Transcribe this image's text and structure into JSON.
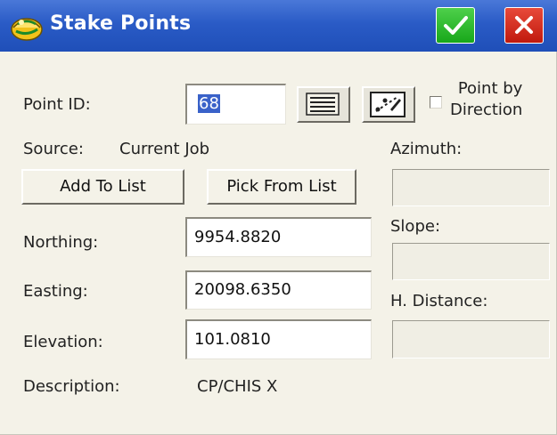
{
  "window": {
    "title": "Stake Points",
    "ok_icon": "checkmark-icon",
    "close_icon": "close-icon",
    "app_icon": "survey-app-icon"
  },
  "point_id": {
    "label": "Point ID:",
    "value": "68",
    "list_icon": "list-icon",
    "map_icon": "map-pick-icon"
  },
  "point_by_direction": {
    "line1": "Point by",
    "line2": "Direction",
    "checked": false
  },
  "source": {
    "label": "Source:",
    "value": "Current Job"
  },
  "buttons": {
    "add_to_list": "Add To List",
    "pick_from_list": "Pick From List"
  },
  "fields": {
    "northing_label": "Northing:",
    "northing_value": "9954.8820",
    "easting_label": "Easting:",
    "easting_value": "20098.6350",
    "elevation_label": "Elevation:",
    "elevation_value": "101.0810",
    "description_label": "Description:",
    "description_value": "CP/CHIS X"
  },
  "direction": {
    "azimuth_label": "Azimuth:",
    "azimuth_value": "",
    "slope_label": "Slope:",
    "slope_value": "",
    "h_distance_label": "H. Distance:",
    "h_distance_value": ""
  }
}
